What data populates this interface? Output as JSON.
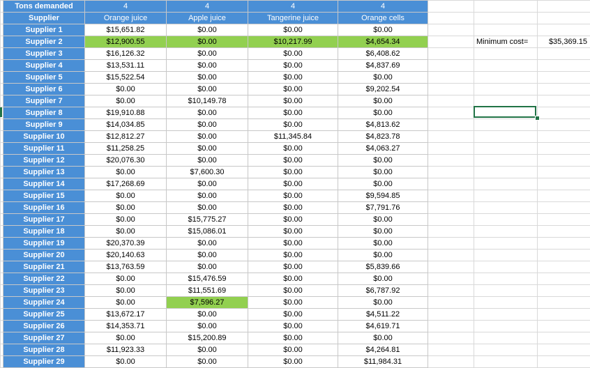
{
  "header_row": {
    "label": "Tons demanded",
    "values": [
      "4",
      "4",
      "4",
      "4"
    ]
  },
  "columns_row": {
    "label": "Supplier",
    "names": [
      "Orange juice",
      "Apple juice",
      "Tangerine juice",
      "Orange cells"
    ]
  },
  "rows": [
    {
      "supplier": "Supplier 1",
      "cells": [
        "$15,651.82",
        "$0.00",
        "$0.00",
        "$0.00"
      ]
    },
    {
      "supplier": "Supplier 2",
      "cells": [
        "$12,900.55",
        "$0.00",
        "$10,217.99",
        "$4,654.34"
      ]
    },
    {
      "supplier": "Supplier 3",
      "cells": [
        "$16,126.32",
        "$0.00",
        "$0.00",
        "$6,408.62"
      ]
    },
    {
      "supplier": "Supplier 4",
      "cells": [
        "$13,531.11",
        "$0.00",
        "$0.00",
        "$4,837.69"
      ]
    },
    {
      "supplier": "Supplier 5",
      "cells": [
        "$15,522.54",
        "$0.00",
        "$0.00",
        "$0.00"
      ]
    },
    {
      "supplier": "Supplier 6",
      "cells": [
        "$0.00",
        "$0.00",
        "$0.00",
        "$9,202.54"
      ]
    },
    {
      "supplier": "Supplier 7",
      "cells": [
        "$0.00",
        "$10,149.78",
        "$0.00",
        "$0.00"
      ]
    },
    {
      "supplier": "Supplier 8",
      "cells": [
        "$19,910.88",
        "$0.00",
        "$0.00",
        "$0.00"
      ]
    },
    {
      "supplier": "Supplier 9",
      "cells": [
        "$14,034.85",
        "$0.00",
        "$0.00",
        "$4,813.62"
      ]
    },
    {
      "supplier": "Supplier 10",
      "cells": [
        "$12,812.27",
        "$0.00",
        "$11,345.84",
        "$4,823.78"
      ]
    },
    {
      "supplier": "Supplier 11",
      "cells": [
        "$11,258.25",
        "$0.00",
        "$0.00",
        "$4,063.27"
      ]
    },
    {
      "supplier": "Supplier 12",
      "cells": [
        "$20,076.30",
        "$0.00",
        "$0.00",
        "$0.00"
      ]
    },
    {
      "supplier": "Supplier 13",
      "cells": [
        "$0.00",
        "$7,600.30",
        "$0.00",
        "$0.00"
      ]
    },
    {
      "supplier": "Supplier 14",
      "cells": [
        "$17,268.69",
        "$0.00",
        "$0.00",
        "$0.00"
      ]
    },
    {
      "supplier": "Supplier 15",
      "cells": [
        "$0.00",
        "$0.00",
        "$0.00",
        "$9,594.85"
      ]
    },
    {
      "supplier": "Supplier 16",
      "cells": [
        "$0.00",
        "$0.00",
        "$0.00",
        "$7,791.76"
      ]
    },
    {
      "supplier": "Supplier 17",
      "cells": [
        "$0.00",
        "$15,775.27",
        "$0.00",
        "$0.00"
      ]
    },
    {
      "supplier": "Supplier 18",
      "cells": [
        "$0.00",
        "$15,086.01",
        "$0.00",
        "$0.00"
      ]
    },
    {
      "supplier": "Supplier 19",
      "cells": [
        "$20,370.39",
        "$0.00",
        "$0.00",
        "$0.00"
      ]
    },
    {
      "supplier": "Supplier 20",
      "cells": [
        "$20,140.63",
        "$0.00",
        "$0.00",
        "$0.00"
      ]
    },
    {
      "supplier": "Supplier 21",
      "cells": [
        "$13,763.59",
        "$0.00",
        "$0.00",
        "$5,839.66"
      ]
    },
    {
      "supplier": "Supplier 22",
      "cells": [
        "$0.00",
        "$15,476.59",
        "$0.00",
        "$0.00"
      ]
    },
    {
      "supplier": "Supplier 23",
      "cells": [
        "$0.00",
        "$11,551.69",
        "$0.00",
        "$6,787.92"
      ]
    },
    {
      "supplier": "Supplier 24",
      "cells": [
        "$0.00",
        "$7,596.27",
        "$0.00",
        "$0.00"
      ]
    },
    {
      "supplier": "Supplier 25",
      "cells": [
        "$13,672.17",
        "$0.00",
        "$0.00",
        "$4,511.22"
      ]
    },
    {
      "supplier": "Supplier 26",
      "cells": [
        "$14,353.71",
        "$0.00",
        "$0.00",
        "$4,619.71"
      ]
    },
    {
      "supplier": "Supplier 27",
      "cells": [
        "$0.00",
        "$15,200.89",
        "$0.00",
        "$0.00"
      ]
    },
    {
      "supplier": "Supplier 28",
      "cells": [
        "$11,923.33",
        "$0.00",
        "$0.00",
        "$4,264.81"
      ]
    },
    {
      "supplier": "Supplier 29",
      "cells": [
        "$0.00",
        "$0.00",
        "$0.00",
        "$11,984.31"
      ]
    }
  ],
  "highlighted_cells": [
    {
      "row": 1,
      "col": 0
    },
    {
      "row": 1,
      "col": 1
    },
    {
      "row": 1,
      "col": 2
    },
    {
      "row": 1,
      "col": 3
    },
    {
      "row": 23,
      "col": 1
    }
  ],
  "summary": {
    "min_cost_label": "Minimum cost=",
    "min_cost_value": "$35,369.15"
  },
  "colors": {
    "header_blue": "#4a8fd6",
    "highlight_green": "#92d050",
    "selection_green": "#217346"
  }
}
